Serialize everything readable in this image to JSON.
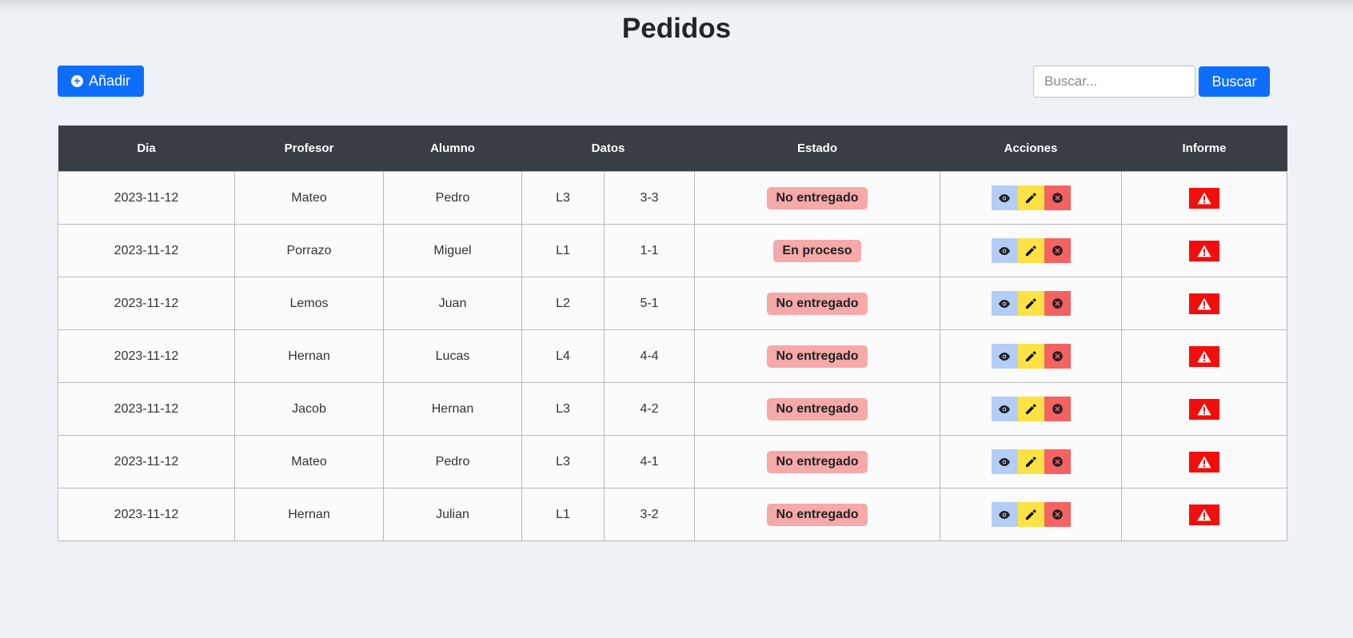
{
  "page": {
    "title": "Pedidos"
  },
  "toolbar": {
    "add_label": "Añadir",
    "search_placeholder": "Buscar...",
    "search_value": "",
    "search_label": "Buscar"
  },
  "table": {
    "headers": {
      "dia": "Dia",
      "profesor": "Profesor",
      "alumno": "Alumno",
      "datos": "Datos",
      "estado": "Estado",
      "acciones": "Acciones",
      "informe": "Informe"
    },
    "rows": [
      {
        "dia": "2023-11-12",
        "profesor": "Mateo",
        "alumno": "Pedro",
        "dato1": "L3",
        "dato2": "3-3",
        "estado": "No entregado"
      },
      {
        "dia": "2023-11-12",
        "profesor": "Porrazo",
        "alumno": "Miguel",
        "dato1": "L1",
        "dato2": "1-1",
        "estado": "En proceso"
      },
      {
        "dia": "2023-11-12",
        "profesor": "Lemos",
        "alumno": "Juan",
        "dato1": "L2",
        "dato2": "5-1",
        "estado": "No entregado"
      },
      {
        "dia": "2023-11-12",
        "profesor": "Hernan",
        "alumno": "Lucas",
        "dato1": "L4",
        "dato2": "4-4",
        "estado": "No entregado"
      },
      {
        "dia": "2023-11-12",
        "profesor": "Jacob",
        "alumno": "Hernan",
        "dato1": "L3",
        "dato2": "4-2",
        "estado": "No entregado"
      },
      {
        "dia": "2023-11-12",
        "profesor": "Mateo",
        "alumno": "Pedro",
        "dato1": "L3",
        "dato2": "4-1",
        "estado": "No entregado"
      },
      {
        "dia": "2023-11-12",
        "profesor": "Hernan",
        "alumno": "Julian",
        "dato1": "L1",
        "dato2": "3-2",
        "estado": "No entregado"
      }
    ],
    "action_icons": [
      "eye-icon",
      "pencil-icon",
      "close-circle-icon"
    ],
    "report_icon": "warning-icon"
  },
  "colors": {
    "primary": "#0d6efd",
    "header_bg": "#393e46",
    "badge_bg": "#f5a9a9",
    "view_bg": "#b3cdf6",
    "edit_bg": "#fde245",
    "delete_bg": "#f56262",
    "report_bg": "#f30d0d"
  }
}
